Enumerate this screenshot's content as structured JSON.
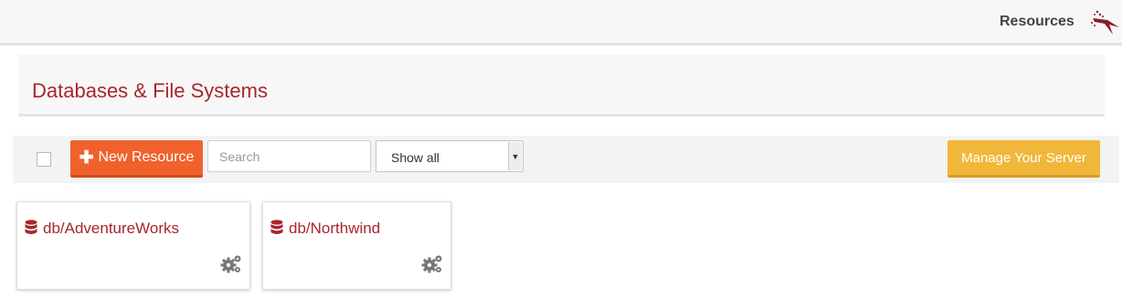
{
  "topbar": {
    "nav_link": "Resources",
    "logo_icon": "bird-logo-icon"
  },
  "header": {
    "title": "Databases & File Systems"
  },
  "toolbar": {
    "new_resource_label": "New Resource",
    "new_resource_icon": "plus-icon",
    "search_placeholder": "Search",
    "filter_value": "Show all",
    "manage_label": "Manage Your Server"
  },
  "resources": [
    {
      "name": "db/AdventureWorks",
      "icon": "database-icon",
      "action_icon": "gears-icon"
    },
    {
      "name": "db/Northwind",
      "icon": "database-icon",
      "action_icon": "gears-icon"
    }
  ],
  "colors": {
    "accent_red": "#a8262b",
    "new_button": "#f0612c",
    "manage_button": "#f0b73b"
  }
}
